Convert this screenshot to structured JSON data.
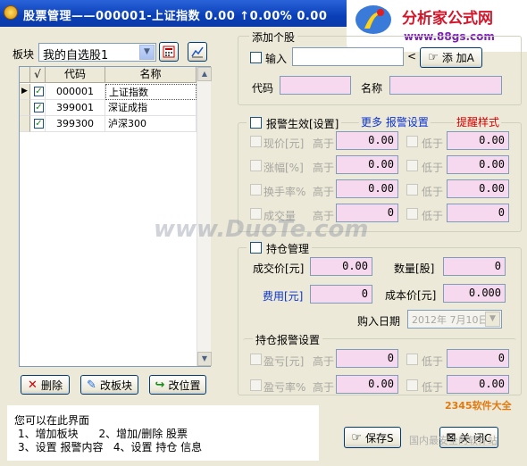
{
  "window": {
    "title": "股票管理——000001-上证指数  0.00  ↑0.00%  0.00"
  },
  "brand": {
    "name": "分析家公式网",
    "url": "www.88gs.com"
  },
  "left": {
    "block_label": "板块",
    "block_value": "我的自选股1",
    "columns": [
      "√",
      "代码",
      "名称"
    ],
    "rows": [
      {
        "code": "000001",
        "name": "上证指数",
        "checked": true,
        "current": true
      },
      {
        "code": "399001",
        "name": "深证成指",
        "checked": true,
        "current": false
      },
      {
        "code": "399300",
        "name": "泸深300",
        "checked": true,
        "current": false
      }
    ],
    "buttons": {
      "delete": "删除",
      "change_block": "改板块",
      "move": "改位置"
    }
  },
  "add_stock": {
    "title": "添加个股",
    "input_label": "输入",
    "input_value": "",
    "add_button": "添 加A",
    "code_label": "代码",
    "code_value": "",
    "name_label": "名称",
    "name_value": ""
  },
  "alert": {
    "enable_label": "报警生效[设置]",
    "more_link": "更多 报警设置",
    "style_link": "提醒样式",
    "rows": [
      {
        "label": "现价[元]",
        "high_label": "高于",
        "high": "0.00",
        "low_label": "低于",
        "low": "0.00"
      },
      {
        "label": "涨幅[%]",
        "high_label": "高于",
        "high": "0.00",
        "low_label": "低于",
        "low": "0.00"
      },
      {
        "label": "换手率%",
        "high_label": "高于",
        "high": "0.00",
        "low_label": "低于",
        "low": "0.00"
      },
      {
        "label": "成交量",
        "high_label": "高于",
        "high": "0",
        "low_label": "低于",
        "low": "0"
      }
    ]
  },
  "position": {
    "title": "持仓管理",
    "price_label": "成交价[元]",
    "price_value": "0.00",
    "qty_label": "数量[股]",
    "qty_value": "0",
    "fee_label": "费用[元]",
    "fee_value": "0",
    "cost_label": "成本价[元]",
    "cost_value": "0.000",
    "date_label": "购入日期",
    "date_value": "2012年 7月10日"
  },
  "position_alert": {
    "title": "持仓报警设置",
    "rows": [
      {
        "label": "盈亏[元]",
        "high_label": "高于",
        "high": "0",
        "low_label": "低于",
        "low": "0"
      },
      {
        "label": "盈亏率%",
        "high_label": "高于",
        "high": "0.00",
        "low_label": "低于",
        "low": "0.00"
      }
    ]
  },
  "info": {
    "line1": "您可以在此界面",
    "line2": "1、增加板块      2、增加/删除 股票",
    "line3": "3、设置 报警内容   4、设置 持仓 信息"
  },
  "footer": {
    "save": "保存S",
    "close": "关 闭C"
  },
  "watermarks": {
    "main": "www.DuoTe.com",
    "corner": "2345软件大全",
    "bottom": "国内最安全的软件站"
  }
}
